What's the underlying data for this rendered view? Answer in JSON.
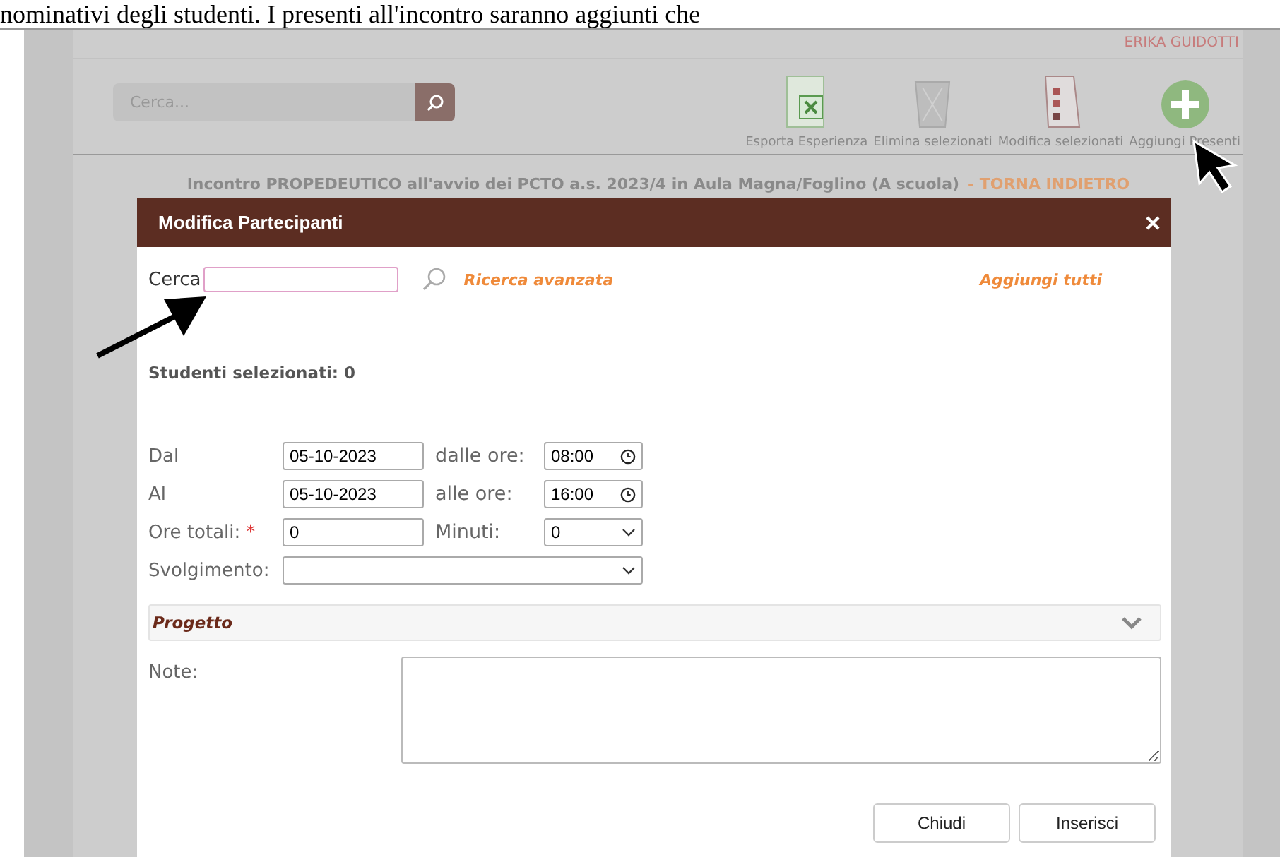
{
  "top_text": "nominativi degli studenti. I presenti all'incontro saranno aggiunti che",
  "header": {
    "user": "ERIKA GUIDOTTI"
  },
  "toolbar": {
    "search": {
      "placeholder": "Cerca..."
    },
    "actions": [
      {
        "kind": "excel",
        "label": "Esporta Esperienza"
      },
      {
        "kind": "trash",
        "label": "Elimina selezionati"
      },
      {
        "kind": "checklist",
        "label": "Modifica selezionati"
      },
      {
        "kind": "add",
        "label": "Aggiungi Presenti"
      }
    ]
  },
  "page_title": "Incontro PROPEDEUTICO all'avvio dei PCTO a.s. 2023/4 in Aula Magna/Foglino (A scuola)",
  "back_link": "- TORNA INDIETRO",
  "dialog": {
    "title": "Modifica Partecipanti",
    "search_label": "Cerca",
    "advanced_link": "Ricerca avanzata",
    "add_all_link": "Aggiungi tutti",
    "selected_count": "Studenti selezionati: 0",
    "rows": [
      {
        "kind": "time",
        "label": "Dal",
        "value": "05-10-2023",
        "label2": "dalle ore:",
        "value2": "08:00"
      },
      {
        "kind": "time",
        "label": "Al",
        "value": "05-10-2023",
        "label2": "alle ore:",
        "value2": "16:00"
      },
      {
        "kind": "select",
        "label": "Ore totali:",
        "required_mark": "*",
        "value": "0",
        "label2": "Minuti:",
        "value2": "0"
      },
      {
        "kind": "wide-select",
        "label": "Svolgimento:"
      }
    ],
    "section": {
      "title": "Progetto",
      "expanded": false
    },
    "note_label": "Note:",
    "buttons": [
      "Chiudi",
      "Inserisci"
    ]
  }
}
